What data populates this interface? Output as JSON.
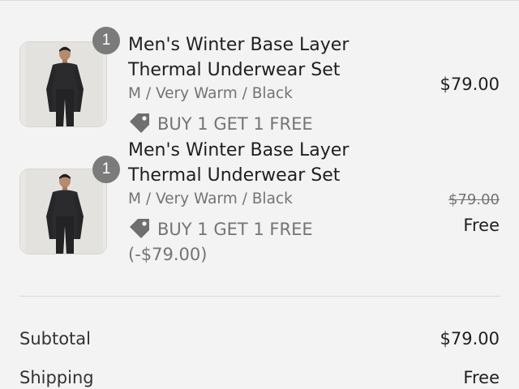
{
  "items": [
    {
      "quantity": "1",
      "title": "Men's Winter Base Layer Thermal Underwear Set",
      "variant": "M / Very Warm / Black",
      "promo": "BUY 1 GET 1 FREE",
      "price": "$79.00",
      "image_icon": "product-photo"
    },
    {
      "quantity": "1",
      "title": "Men's Winter Base Layer Thermal Underwear Set",
      "variant": "M / Very Warm / Black",
      "promo": "BUY 1 GET 1 FREE (-$79.00)",
      "original_price": "$79.00",
      "price": "Free",
      "image_icon": "product-photo"
    }
  ],
  "summary": {
    "subtotal_label": "Subtotal",
    "subtotal_value": "$79.00",
    "shipping_label": "Shipping",
    "shipping_value": "Free"
  },
  "colors": {
    "badge": "#7b7b7b",
    "muted_text": "#747474",
    "background": "#f3f3f3"
  }
}
